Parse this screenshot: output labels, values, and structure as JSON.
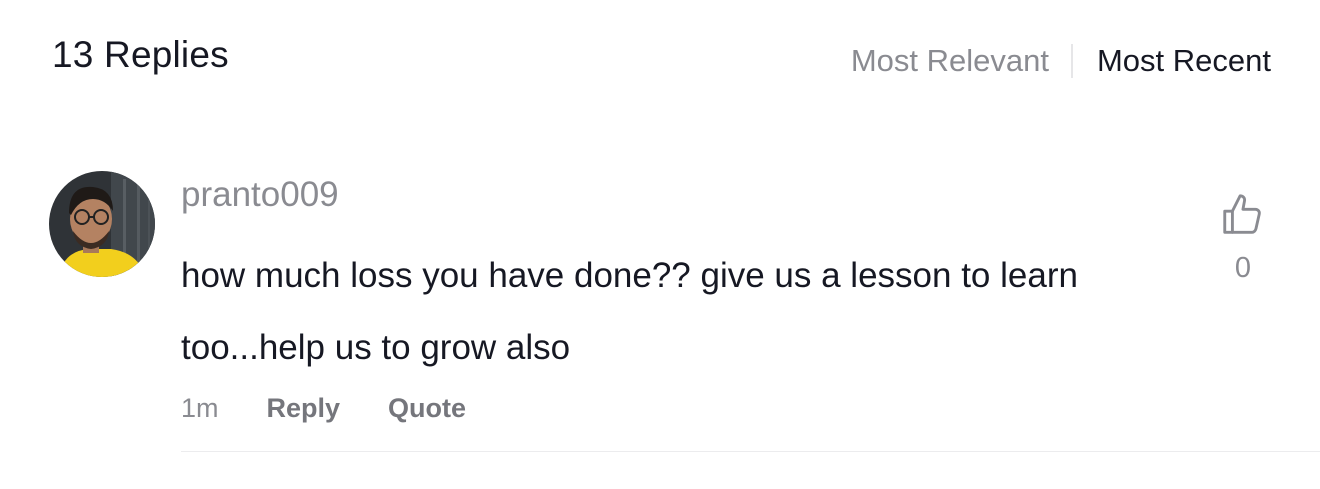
{
  "header": {
    "title": "13 Replies",
    "sort_options": [
      "Most Relevant",
      "Most Recent"
    ],
    "active_sort": "Most Recent"
  },
  "comment": {
    "username": "pranto009",
    "text": "how much loss you have done?? give us a lesson to learn too...help us to grow also",
    "time": "1m",
    "reply_label": "Reply",
    "quote_label": "Quote",
    "like_count": "0",
    "like_icon": "thumbs-up-icon",
    "avatar_icon": "avatar"
  },
  "colors": {
    "primary_text": "#161823",
    "secondary_text": "#8a8b91",
    "divider": "#ececee"
  }
}
